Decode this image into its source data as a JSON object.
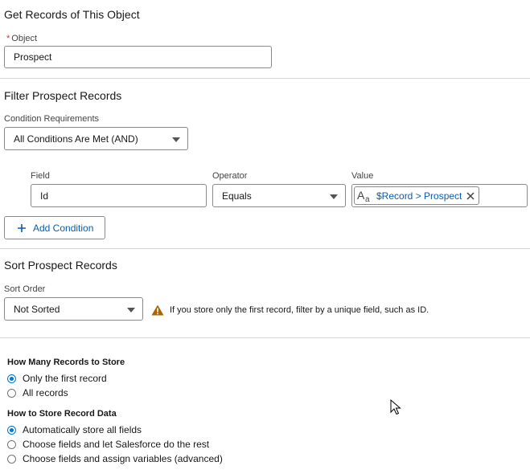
{
  "get_records": {
    "title": "Get Records of This Object",
    "object_label": "Object",
    "required_mark": "*",
    "object_value": "Prospect"
  },
  "filter": {
    "title": "Filter Prospect Records",
    "condition_label": "Condition Requirements",
    "condition_value": "All Conditions Are Met (AND)",
    "field_label": "Field",
    "field_value": "Id",
    "operator_label": "Operator",
    "operator_value": "Equals",
    "value_label": "Value",
    "value_pill": "$Record > Prospect",
    "value_pill_icon": "text-resource-icon",
    "add_condition_label": "Add Condition"
  },
  "sort": {
    "title": "Sort Prospect Records",
    "order_label": "Sort Order",
    "order_value": "Not Sorted",
    "warning_text": "If you store only the first record, filter by a unique field, such as ID.",
    "warning_color": "#a96404"
  },
  "store": {
    "how_many_title": "How Many Records to Store",
    "how_many_options": [
      {
        "label": "Only the first record",
        "selected": true
      },
      {
        "label": "All records",
        "selected": false
      }
    ],
    "how_title": "How to Store Record Data",
    "how_options": [
      {
        "label": "Automatically store all fields",
        "selected": true
      },
      {
        "label": "Choose fields and let Salesforce do the rest",
        "selected": false
      },
      {
        "label": "Choose fields and assign variables (advanced)",
        "selected": false
      }
    ]
  },
  "colors": {
    "brand": "#0176d3",
    "link": "#0b5cab"
  }
}
